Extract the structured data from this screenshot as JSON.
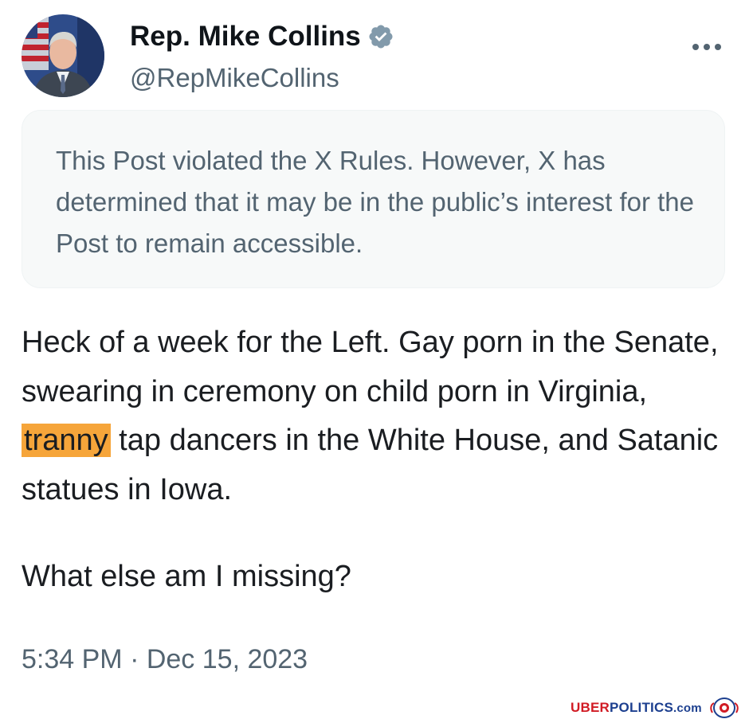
{
  "author": {
    "display_name": "Rep. Mike Collins",
    "handle": "@RepMikeCollins",
    "avatar_icon": "profile-photo"
  },
  "notice": {
    "text": "This Post violated the X Rules. However, X has determined that it may be in the public’s interest for the Post to remain accessible."
  },
  "post": {
    "text_before": "Heck of a week for the Left. Gay porn in the Senate, swearing in ceremony on child porn in Virginia, ",
    "highlighted_word": "tranny",
    "text_after": " tap dancers in the White House, and Satanic statues in Iowa.",
    "text_para2": "What else am I missing?",
    "highlight_color": "#f6a53a"
  },
  "timestamp": "5:34 PM · Dec 15, 2023",
  "watermark": {
    "part1": "UBER",
    "part2": "POLITICS",
    "part3": ".com"
  },
  "colors": {
    "verified_badge": "#829aab",
    "secondary_text": "#536471",
    "notice_background": "#f7f9f9"
  }
}
